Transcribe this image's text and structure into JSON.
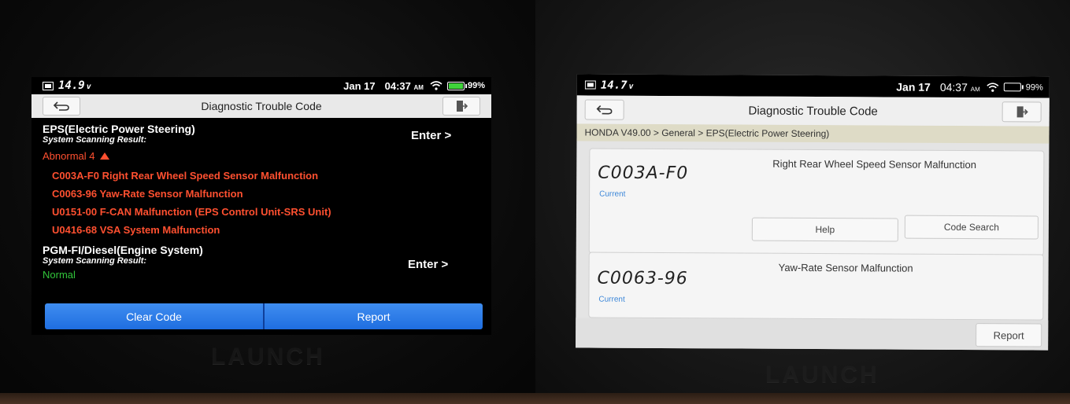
{
  "left": {
    "status_bar": {
      "voltage": "14.9",
      "voltage_unit": "v",
      "date": "Jan 17",
      "time": "04:37",
      "ampm": "AM",
      "battery": "99%"
    },
    "header": {
      "title": "Diagnostic Trouble Code"
    },
    "systems": [
      {
        "name": "EPS(Electric Power Steering)",
        "sub": "System Scanning Result:",
        "enter": "Enter >",
        "status": "Abnormal 4",
        "dtcs": [
          "C003A-F0 Right Rear Wheel Speed Sensor Malfunction",
          "C0063-96 Yaw-Rate Sensor Malfunction",
          "U0151-00 F-CAN Malfunction (EPS Control Unit-SRS Unit)",
          "U0416-68 VSA System Malfunction"
        ]
      },
      {
        "name": "PGM-FI/Diesel(Engine System)",
        "sub": "System Scanning Result:",
        "enter": "Enter >",
        "status": "Normal"
      }
    ],
    "buttons": {
      "clear": "Clear Code",
      "report": "Report"
    },
    "brand": "LAUNCH"
  },
  "right": {
    "status_bar": {
      "voltage": "14.7",
      "voltage_unit": "v",
      "date": "Jan 17",
      "time": "04:37",
      "ampm": "AM",
      "battery": "99%"
    },
    "header": {
      "title": "Diagnostic Trouble Code"
    },
    "breadcrumb": "HONDA V49.00 > General > EPS(Electric Power Steering)",
    "cards": [
      {
        "code": "C003A-F0",
        "status": "Current",
        "desc": "Right Rear Wheel Speed Sensor Malfunction",
        "help": "Help",
        "search": "Code Search"
      },
      {
        "code": "C0063-96",
        "status": "Current",
        "desc": "Yaw-Rate Sensor Malfunction"
      }
    ],
    "report": "Report",
    "brand": "LAUNCH"
  },
  "colors": {
    "dtc_red": "#ff5030",
    "normal_green": "#31c53a",
    "button_blue": "#1f6ee0",
    "current_blue": "#3b86d8"
  }
}
